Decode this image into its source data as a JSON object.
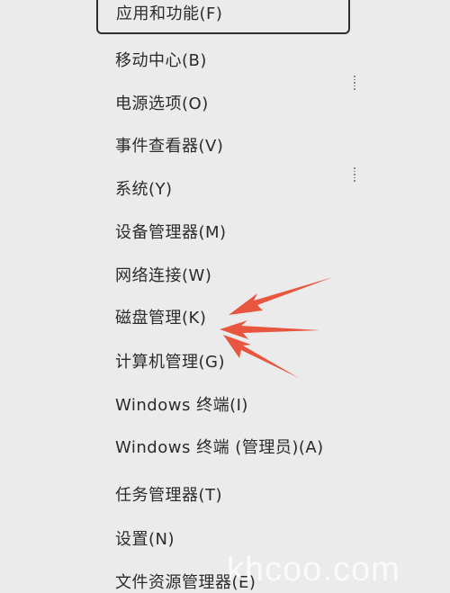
{
  "menu": {
    "items": [
      {
        "label": "应用和功能(F)"
      },
      {
        "label": "移动中心(B)"
      },
      {
        "label": "电源选项(O)"
      },
      {
        "label": "事件查看器(V)"
      },
      {
        "label": "系统(Y)"
      },
      {
        "label": "设备管理器(M)"
      },
      {
        "label": "网络连接(W)"
      },
      {
        "label": "磁盘管理(K)"
      },
      {
        "label": "计算机管理(G)"
      },
      {
        "label": "Windows 终端(I)"
      },
      {
        "label": "Windows 终端 (管理员)(A)"
      },
      {
        "label": "任务管理器(T)"
      },
      {
        "label": "设置(N)"
      },
      {
        "label": "文件资源管理器(E)"
      }
    ],
    "focused_item": "应用和功能(F)"
  },
  "annotation": {
    "arrow_color": "#e8563f"
  },
  "watermark": {
    "text": "khcoo.com"
  }
}
